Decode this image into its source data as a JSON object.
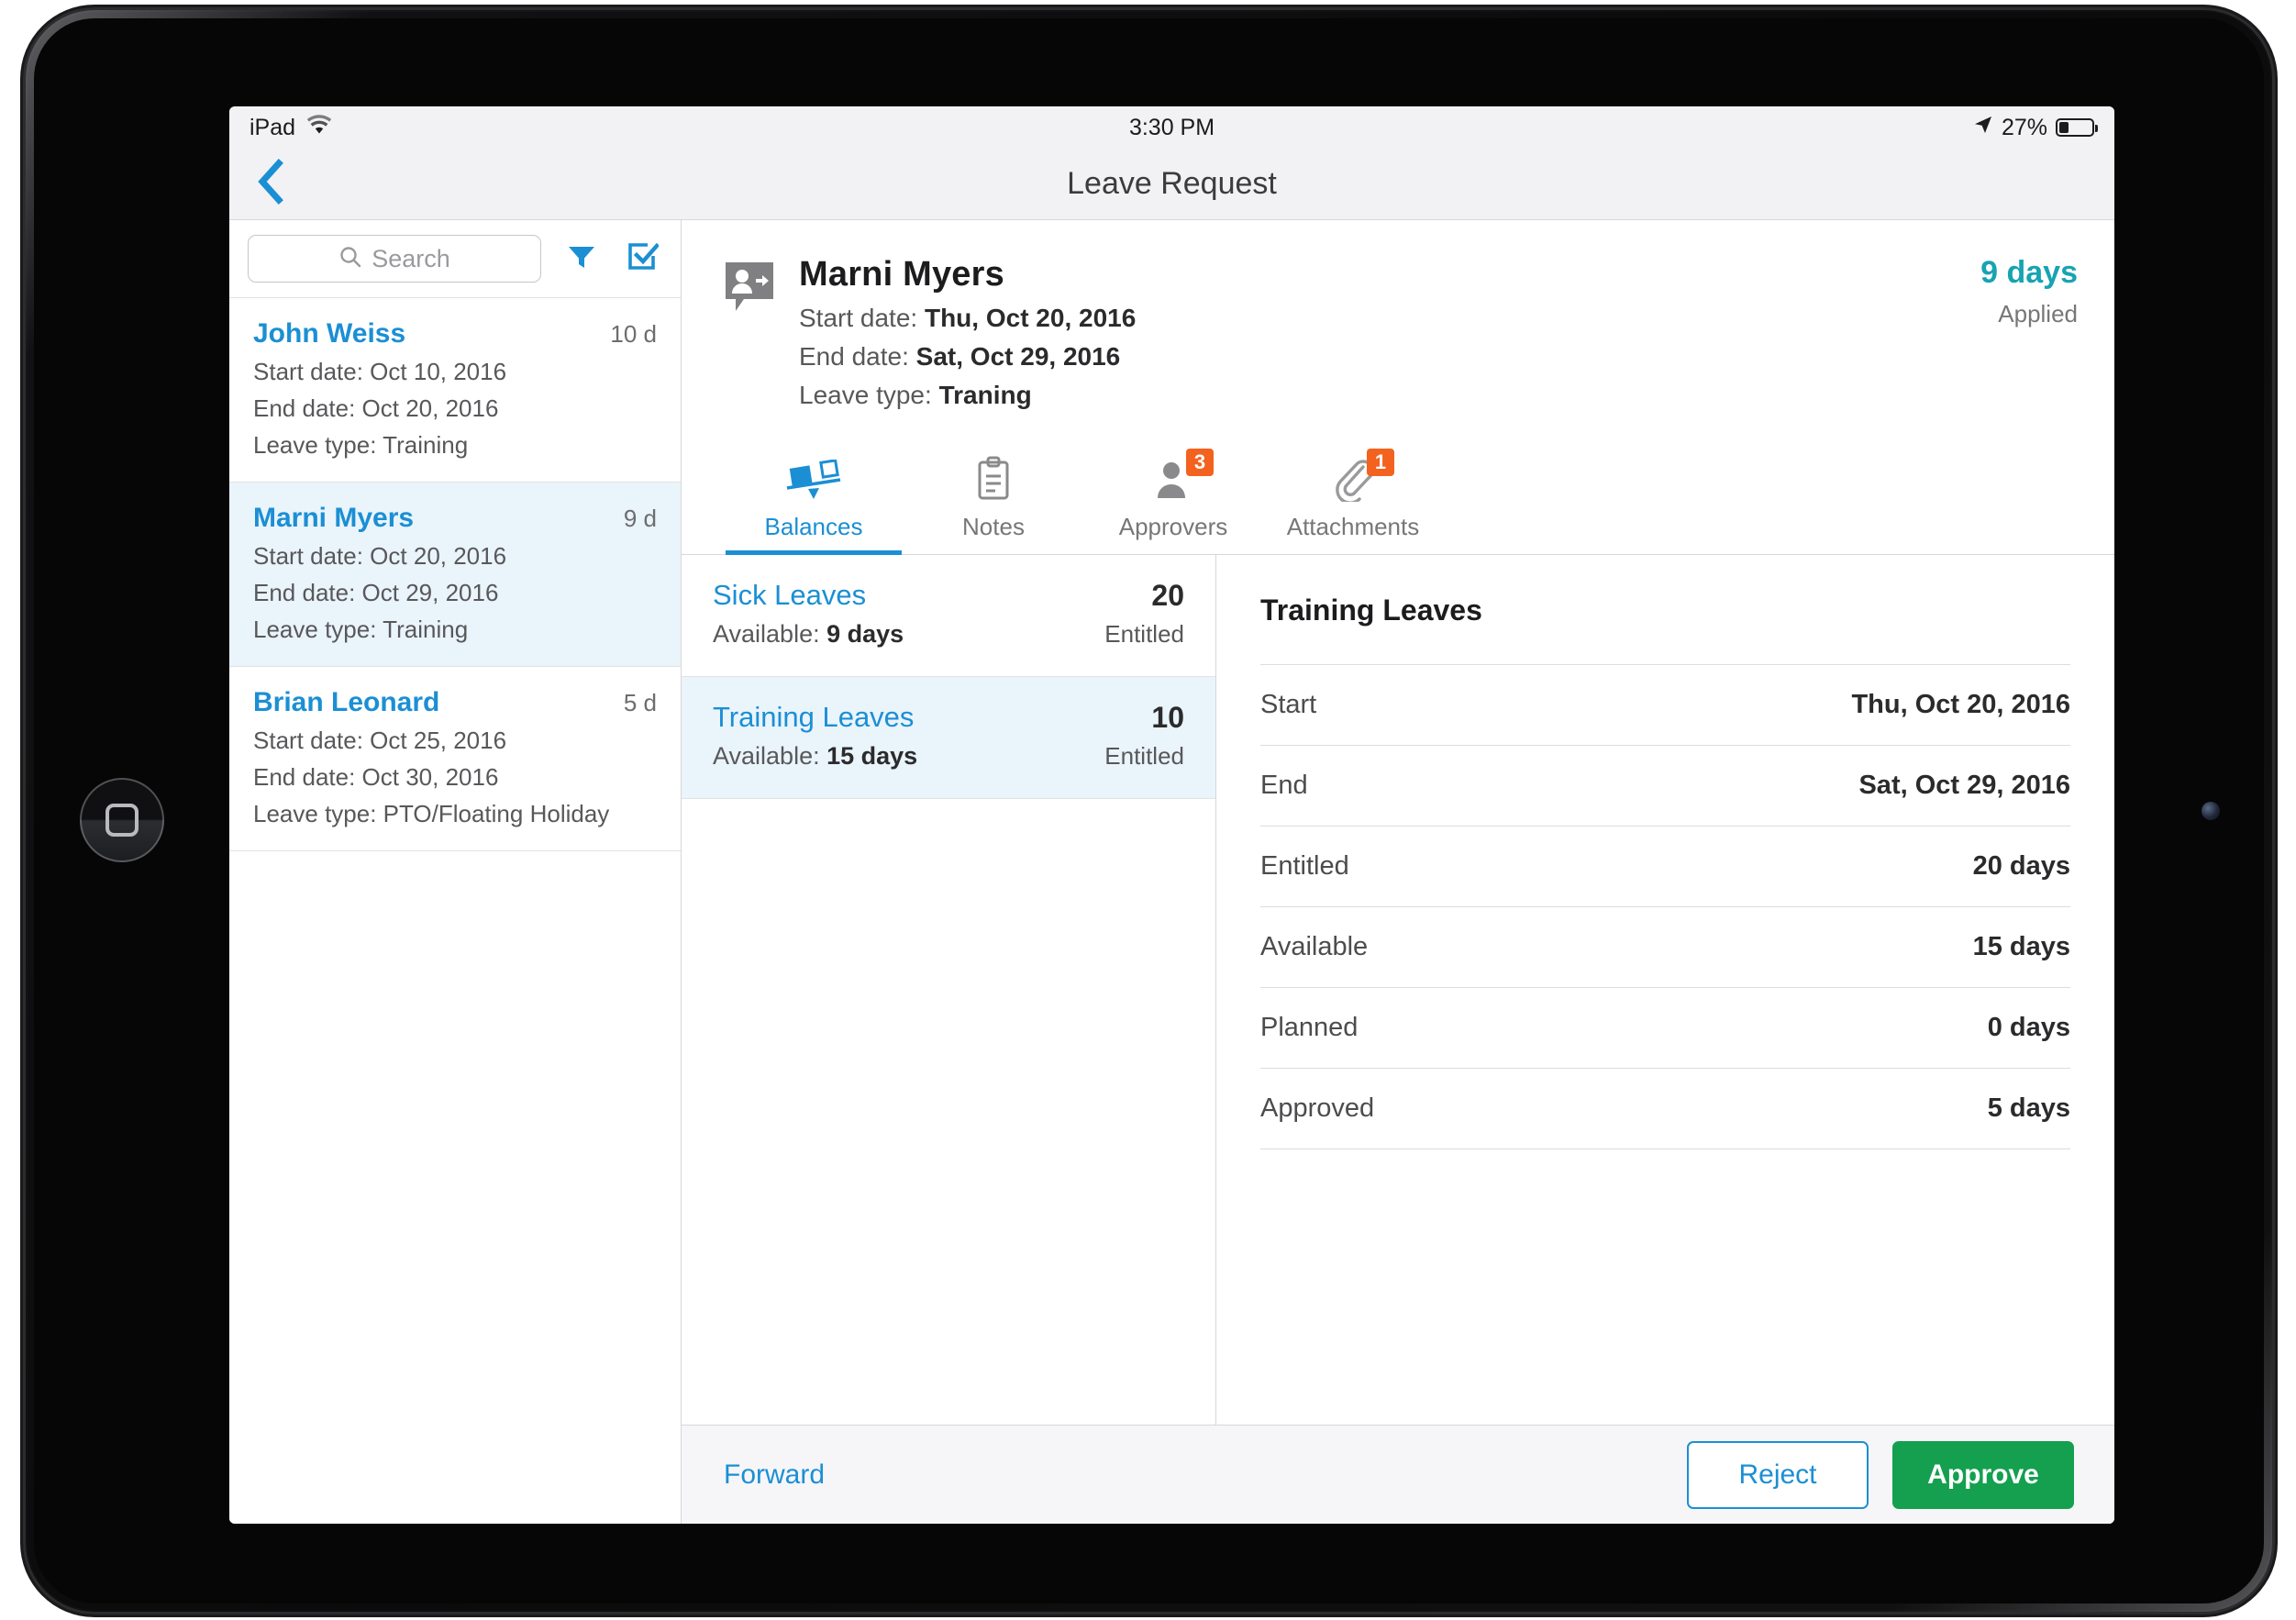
{
  "status_bar": {
    "device_label": "iPad",
    "wifi_icon": "wifi-icon",
    "time": "3:30 PM",
    "location_icon": "location-arrow-icon",
    "battery_percent": "27%",
    "battery_level": 27
  },
  "nav": {
    "back_icon": "chevron-left-icon",
    "title": "Leave Request"
  },
  "sidebar": {
    "search": {
      "placeholder": "Search",
      "value": "",
      "icon": "search-icon"
    },
    "filter_icon": "filter-icon",
    "select_icon": "checkbox-checked-icon",
    "items": [
      {
        "name": "John Weiss",
        "days": "10 d",
        "start": "Start date: Oct 10, 2016",
        "end": "End date: Oct 20, 2016",
        "type": "Leave type: Training",
        "selected": false
      },
      {
        "name": "Marni Myers",
        "days": "9 d",
        "start": "Start date: Oct 20, 2016",
        "end": "End date: Oct 29, 2016",
        "type": "Leave type: Training",
        "selected": true
      },
      {
        "name": "Brian Leonard",
        "days": "5 d",
        "start": "Start date: Oct 25, 2016",
        "end": "End date: Oct 30, 2016",
        "type": "Leave type: PTO/Floating Holiday",
        "selected": false
      }
    ]
  },
  "detail": {
    "avatar_icon": "person-request-icon",
    "name": "Marni Myers",
    "start_label": "Start date: ",
    "start_value": "Thu, Oct 20, 2016",
    "end_label": "End date: ",
    "end_value": "Sat, Oct 29, 2016",
    "type_label": "Leave type: ",
    "type_value": "Traning",
    "days": "9 days",
    "status": "Applied",
    "tabs": [
      {
        "label": "Balances",
        "icon": "balance-scale-icon",
        "badge": "",
        "active": true
      },
      {
        "label": "Notes",
        "icon": "clipboard-icon",
        "badge": "",
        "active": false
      },
      {
        "label": "Approvers",
        "icon": "person-icon",
        "badge": "3",
        "active": false
      },
      {
        "label": "Attachments",
        "icon": "paperclip-icon",
        "badge": "1",
        "active": false
      }
    ],
    "balances": [
      {
        "name": "Sick Leaves",
        "available_label": "Available: ",
        "available_value": "9 days",
        "entitled_number": "20",
        "entitled_label": "Entitled",
        "selected": false
      },
      {
        "name": "Training Leaves",
        "available_label": "Available: ",
        "available_value": "15 days",
        "entitled_number": "10",
        "entitled_label": "Entitled",
        "selected": true
      }
    ],
    "balance_detail": {
      "title": "Training Leaves",
      "rows": [
        {
          "label": "Start",
          "value": "Thu, Oct 20, 2016"
        },
        {
          "label": "End",
          "value": "Sat, Oct 29, 2016"
        },
        {
          "label": "Entitled",
          "value": "20 days"
        },
        {
          "label": "Available",
          "value": "15 days"
        },
        {
          "label": "Planned",
          "value": "0 days"
        },
        {
          "label": "Approved",
          "value": "5 days"
        }
      ]
    }
  },
  "footer": {
    "forward_label": "Forward",
    "reject_label": "Reject",
    "approve_label": "Approve"
  },
  "colors": {
    "accent_blue": "#1b8fd4",
    "teal": "#17a3b2",
    "badge_orange": "#f4621f",
    "approve_green": "#14a04f",
    "selected_row": "#eaf4fb"
  }
}
